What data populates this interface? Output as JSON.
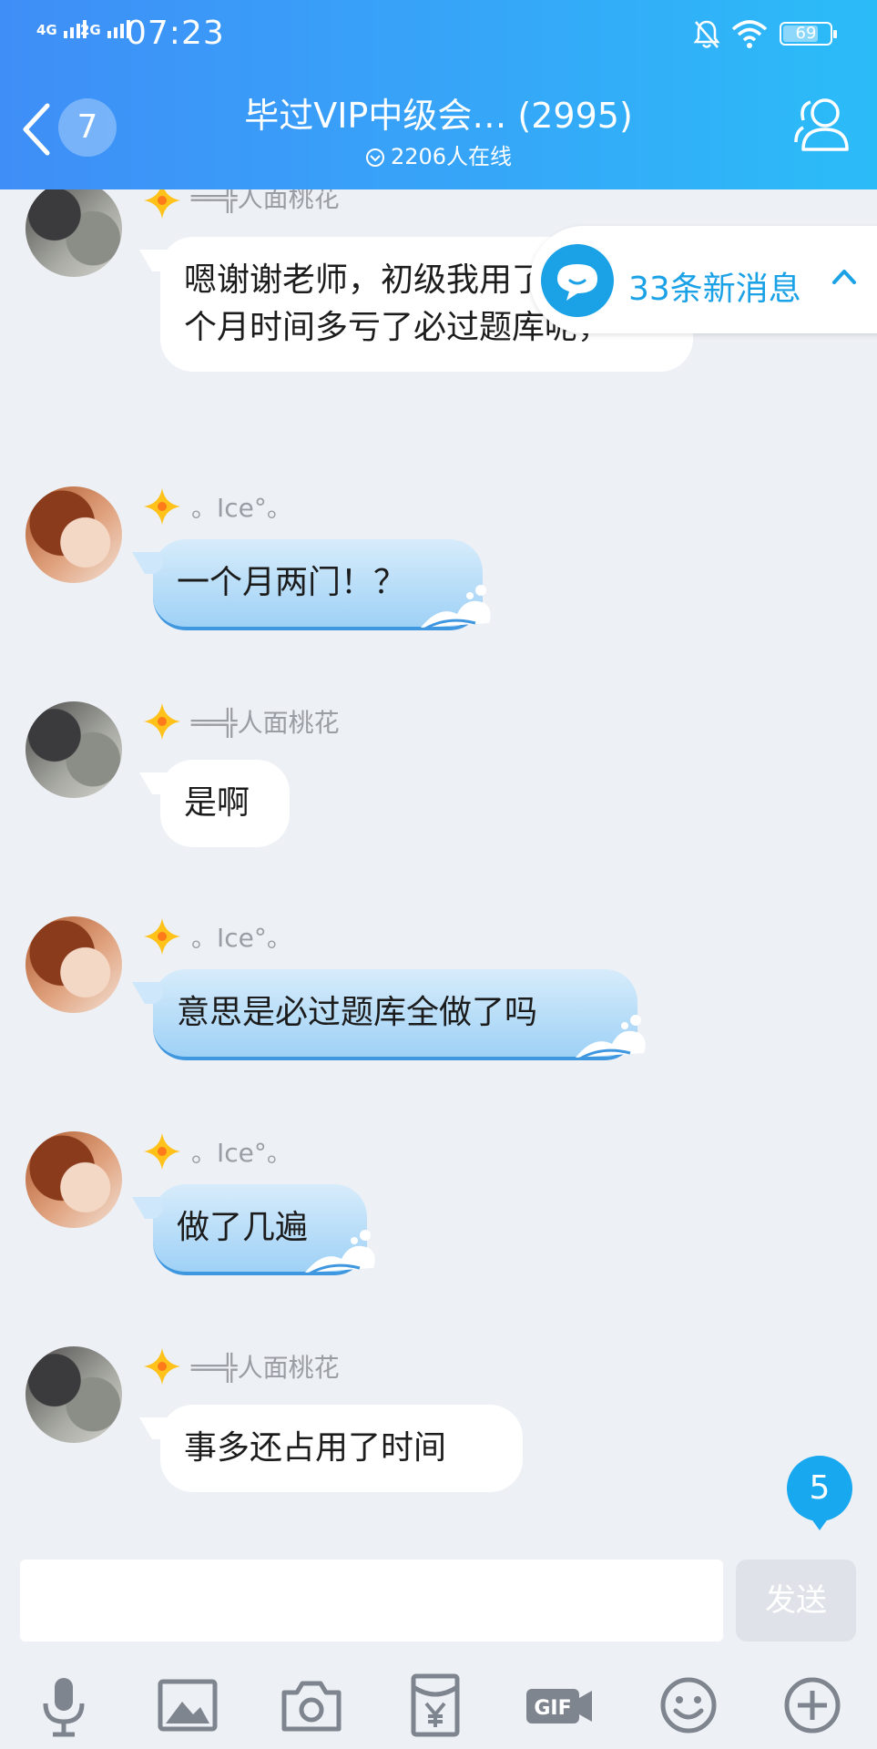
{
  "status_bar": {
    "network_1": "4G",
    "network_2": "2G",
    "time": "07:23",
    "battery": "69"
  },
  "header": {
    "unread_count": "7",
    "title": "毕过VIP中级会… (2995)",
    "online": "2206人在线"
  },
  "new_messages": {
    "label": "33条新消息"
  },
  "messages": [
    {
      "sender": "══╬人面桃花",
      "text": "嗯谢谢老师，初级我用了不到一个月时间多亏了必过题库呢，",
      "style": "white",
      "avatar": "avatar-a"
    },
    {
      "sender": "。Ice°。",
      "text": "一个月两门！？",
      "style": "blue",
      "avatar": "avatar-b"
    },
    {
      "sender": "══╬人面桃花",
      "text": "是啊",
      "style": "white",
      "avatar": "avatar-a"
    },
    {
      "sender": "。Ice°。",
      "text": "意思是必过题库全做了吗",
      "style": "blue",
      "avatar": "avatar-b"
    },
    {
      "sender": "。Ice°。",
      "text": "做了几遍",
      "style": "blue",
      "avatar": "avatar-b"
    },
    {
      "sender": "══╬人面桃花",
      "text": "事多还占用了时间",
      "style": "white",
      "avatar": "avatar-a"
    }
  ],
  "scroll_badge": "5",
  "composer": {
    "input_value": "",
    "send_label": "发送"
  },
  "toolbar_icons": [
    "microphone-icon",
    "image-icon",
    "camera-icon",
    "red-packet-icon",
    "gif-icon",
    "emoji-icon",
    "plus-icon"
  ],
  "colors": {
    "header_start": "#3f8ef7",
    "header_end": "#2bbcf8",
    "accent": "#1aa1e6",
    "badge": "#18a8ef"
  }
}
